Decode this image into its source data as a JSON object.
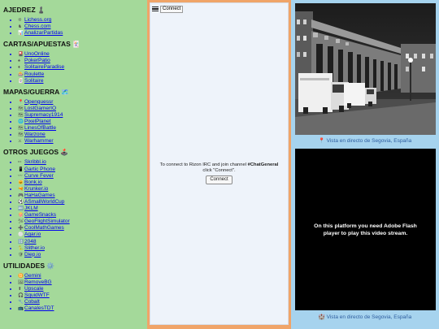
{
  "left_panel": {
    "sections": [
      {
        "title": "AJEDREZ",
        "emoji": "♟️",
        "items": [
          {
            "icon": "❊",
            "label": "Lichess.org"
          },
          {
            "icon": "♞",
            "label": "Chess.com"
          },
          {
            "icon": "📊",
            "label": "AnalizarPartidas"
          }
        ]
      },
      {
        "title": "CARTAS/APUESTAS",
        "emoji": "🃏",
        "items": [
          {
            "icon": "🎴",
            "label": "UnoOnline"
          },
          {
            "icon": "♠",
            "label": "PokerPatio"
          },
          {
            "icon": "♦",
            "label": "SolitaireParadise"
          },
          {
            "icon": "🎰",
            "label": "Roulette"
          },
          {
            "icon": "🃏",
            "label": "Solitaire"
          }
        ]
      },
      {
        "title": "MAPAS/GUERRA",
        "emoji": "🗺️",
        "items": [
          {
            "icon": "📍",
            "label": "Openguessr"
          },
          {
            "icon": "🗺",
            "label": "LostGamerIO"
          },
          {
            "icon": "🗺",
            "label": "Supremacy1914"
          },
          {
            "icon": "🌐",
            "label": "PixelPlanet"
          },
          {
            "icon": "🗺",
            "label": "LinesOfBattle"
          },
          {
            "icon": "🗺",
            "label": "Warzone"
          },
          {
            "icon": "⚔",
            "label": "Warhammer"
          }
        ]
      },
      {
        "title": "OTROS JUEGOS",
        "emoji": "🕹️",
        "items": [
          {
            "icon": "✏",
            "label": "Skribbl.io"
          },
          {
            "icon": "📱",
            "label": "Gartic Phone"
          },
          {
            "icon": "〰",
            "label": "Curve Fever"
          },
          {
            "icon": "🐱",
            "label": "Bonk.io"
          },
          {
            "icon": "🔫",
            "label": "Krunker.io"
          },
          {
            "icon": "🎮",
            "label": "HaHaGames"
          },
          {
            "icon": "⚽",
            "label": "ASmallWorldCup"
          },
          {
            "icon": "🔤",
            "label": "JKLM"
          },
          {
            "icon": "🍿",
            "label": "GameSnacks"
          },
          {
            "icon": "🛩",
            "label": "GeoFlightSimulator"
          },
          {
            "icon": "➕",
            "label": "CoolMathGames"
          },
          {
            "icon": "⚪",
            "label": "Agar.io"
          },
          {
            "icon": "🔢",
            "label": "2048"
          },
          {
            "icon": "🐍",
            "label": "Slither.io"
          },
          {
            "icon": "🛡",
            "label": "Diep.io"
          }
        ]
      },
      {
        "title": "UTILIDADES",
        "emoji": "⚙️",
        "items": [
          {
            "icon": "♊",
            "label": "Gemini"
          },
          {
            "icon": "🖼",
            "label": "RemoveBG"
          },
          {
            "icon": "⬆",
            "label": "Upscale"
          },
          {
            "icon": "🎧",
            "label": "SquidWTF"
          },
          {
            "icon": "🔧",
            "label": "Cobalt"
          },
          {
            "icon": "📺",
            "label": "CanalesTDT"
          }
        ]
      }
    ]
  },
  "chat_panel": {
    "menu_label": "Connect",
    "message_before": "To connect to Rizon IRC and join channel ",
    "channel": "#ChatGeneral",
    "message_after": " click \"Connect\".",
    "connect_button": "Connect"
  },
  "right_panel": {
    "camera_caption": "📍 Vista en directo de Segovia, España",
    "flash_message": "On this platform you need Adobe Flash player to play this video stream.",
    "flash_caption": "🏰 Vista en directo de Segovia, España"
  },
  "colors": {
    "left_bg": "#a4d99a",
    "middle_border": "#f0a468",
    "middle_bg": "#eef3fa",
    "right_bg": "#a6d3ee",
    "link": "#0000ee"
  }
}
